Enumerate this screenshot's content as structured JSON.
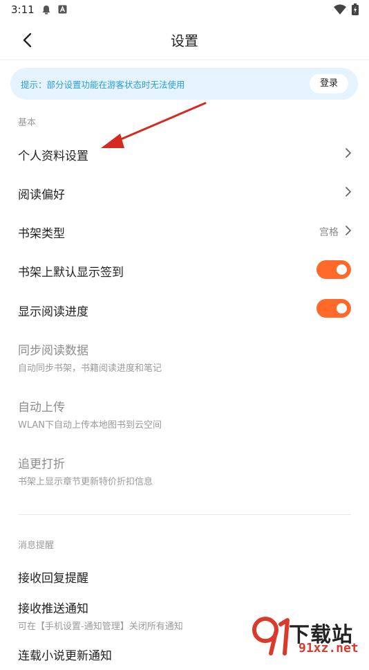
{
  "status_bar": {
    "time": "3:11"
  },
  "header": {
    "title": "设置"
  },
  "tip": {
    "text": "提示：部分设置功能在游客状态时无法使用",
    "login_label": "登录"
  },
  "section_basic": {
    "label": "基本"
  },
  "rows": [
    {
      "title": "个人资料设置",
      "control": "chevron"
    },
    {
      "title": "阅读偏好",
      "control": "chevron"
    },
    {
      "title": "书架类型",
      "value": "宫格",
      "control": "chevron"
    },
    {
      "title": "书架上默认显示签到",
      "control": "toggle",
      "on": true
    },
    {
      "title": "显示阅读进度",
      "control": "toggle",
      "on": true
    },
    {
      "title": "同步阅读数据",
      "subtitle": "自动同步书架，书籍阅读进度和笔记",
      "disabled": true
    },
    {
      "title": "自动上传",
      "subtitle": "WLAN下自动上传本地图书到云空间",
      "disabled": true
    },
    {
      "title": "追更打折",
      "subtitle": "书架上显示章节更新特价折扣信息",
      "disabled": true
    }
  ],
  "section_notify": {
    "label": "消息提醒"
  },
  "notify_rows": [
    {
      "title": "接收回复提醒"
    },
    {
      "title": "接收推送通知",
      "subtitle": "可在【手机设置-通知管理】关闭所有通知"
    },
    {
      "title": "连载小说更新通知"
    }
  ],
  "watermark": {
    "top": "下载站",
    "bottom": "91xz.net"
  },
  "colors": {
    "accent": "#ff6a2b",
    "tip_bg": "#e4f3fd",
    "tip_text": "#2a9de0",
    "arrow": "#d42a22"
  }
}
